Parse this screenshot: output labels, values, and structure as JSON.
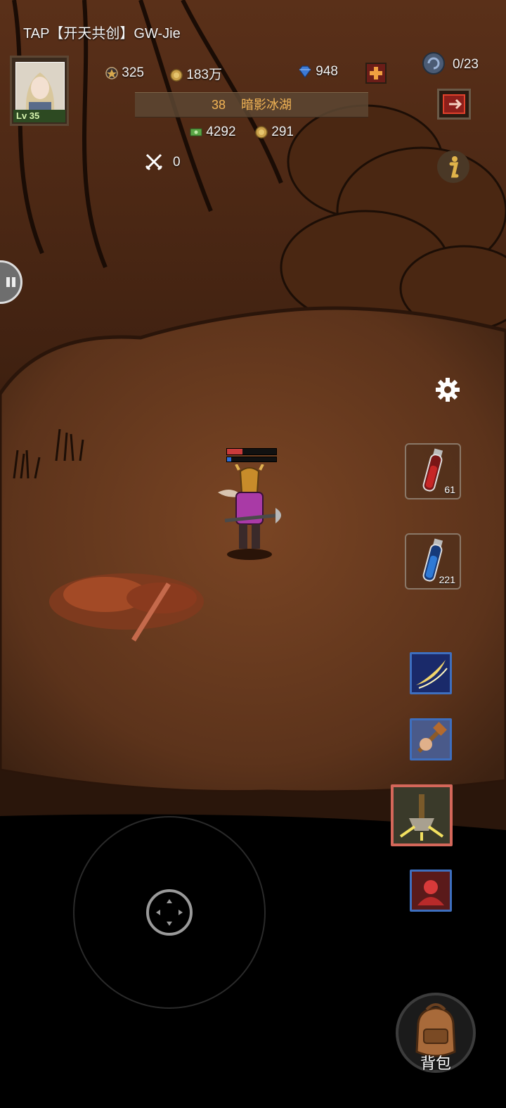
{
  "player": {
    "name": "TAP【开天共创】GW-Jie",
    "level": "Lv 35"
  },
  "resources": {
    "stars": "325",
    "gold": "183万",
    "diamonds": "948",
    "stamina": "0/23",
    "cash": "4292",
    "coins": "291"
  },
  "location": {
    "number": "38",
    "name": "暗影冰湖"
  },
  "kills": "0",
  "potions": {
    "red_count": "61",
    "blue_count": "221"
  },
  "bag": {
    "label": "背包"
  },
  "colors": {
    "accent": "#f2b455",
    "skill_border": "#3e6fbf",
    "active_skill_border": "#d4675a",
    "health": "#c93b3b",
    "mana": "#2f6fd6"
  }
}
